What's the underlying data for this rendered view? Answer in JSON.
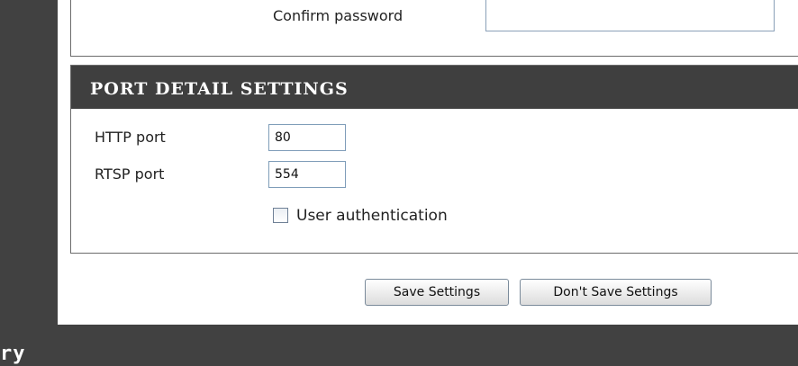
{
  "top_section": {
    "confirm_password_label": "Confirm password",
    "confirm_password_value": ""
  },
  "port_section": {
    "title": "PORT DETAIL SETTINGS",
    "http_label": "HTTP port",
    "http_value": "80",
    "rtsp_label": "RTSP port",
    "rtsp_value": "554",
    "user_auth_label": "User authentication",
    "user_auth_checked": false
  },
  "buttons": {
    "save": "Save Settings",
    "dont_save": "Don't Save Settings"
  },
  "footer": {
    "text": "ry"
  },
  "colors": {
    "dark_bar": "#414141",
    "header_bg": "#3f3f3f",
    "input_border": "#7f9db9"
  }
}
